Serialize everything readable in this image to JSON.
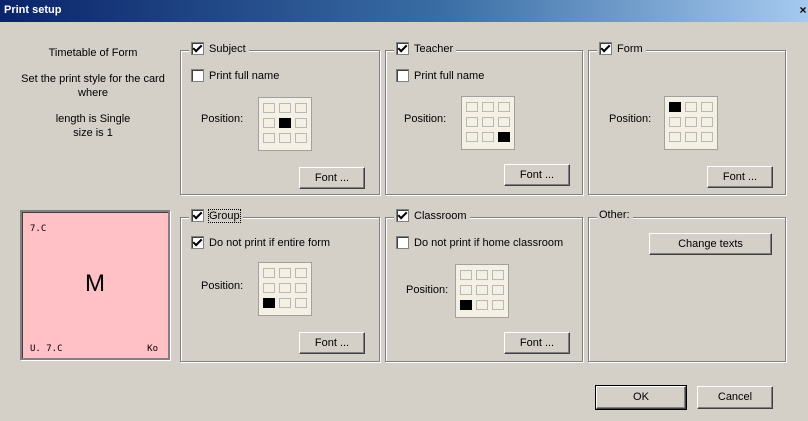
{
  "window": {
    "title": "Print setup",
    "close": "×"
  },
  "info": {
    "line1": "Timetable of Form",
    "line2": "Set the print style for the card where",
    "line3": "length is Single\nsize is 1"
  },
  "card": {
    "top_left": "7.C",
    "center": "M",
    "bottom_left": "U. 7.C",
    "bottom_right": "Ko",
    "background": "#ffc0c6"
  },
  "subject": {
    "label": "Subject",
    "checked": true,
    "option": "Print full name",
    "option_checked": false,
    "position_label": "Position:",
    "position": 4,
    "font": "Font ..."
  },
  "teacher": {
    "label": "Teacher",
    "checked": true,
    "option": "Print full name",
    "option_checked": false,
    "position_label": "Position:",
    "position": 8,
    "font": "Font ..."
  },
  "form": {
    "label": "Form",
    "checked": true,
    "position_label": "Position:",
    "position": 0,
    "font": "Font ..."
  },
  "group": {
    "label": "Group",
    "checked": true,
    "option": "Do not print if entire form",
    "option_checked": true,
    "position_label": "Position:",
    "position": 6,
    "font": "Font ..."
  },
  "classroom": {
    "label": "Classroom",
    "checked": true,
    "option": "Do not print if home classroom",
    "option_checked": false,
    "position_label": "Position:",
    "position": 6,
    "font": "Font ..."
  },
  "other": {
    "label": "Other:",
    "change_texts": "Change texts"
  },
  "footer": {
    "ok": "OK",
    "cancel": "Cancel"
  }
}
